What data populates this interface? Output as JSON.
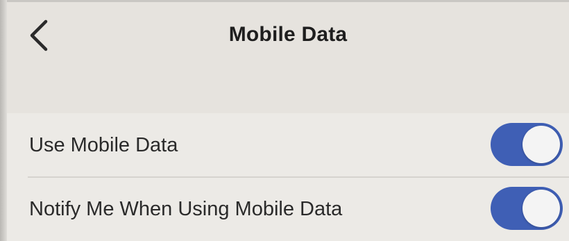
{
  "header": {
    "back_icon": "chevron-left-icon",
    "title": "Mobile Data"
  },
  "settings": {
    "rows": [
      {
        "label": "Use Mobile Data",
        "toggle_on": true
      },
      {
        "label": "Notify Me When Using Mobile Data",
        "toggle_on": true
      }
    ]
  },
  "colors": {
    "toggle_on": "#3f5fb5",
    "background": "#ebe9e5",
    "knob": "#f4f4f4"
  }
}
